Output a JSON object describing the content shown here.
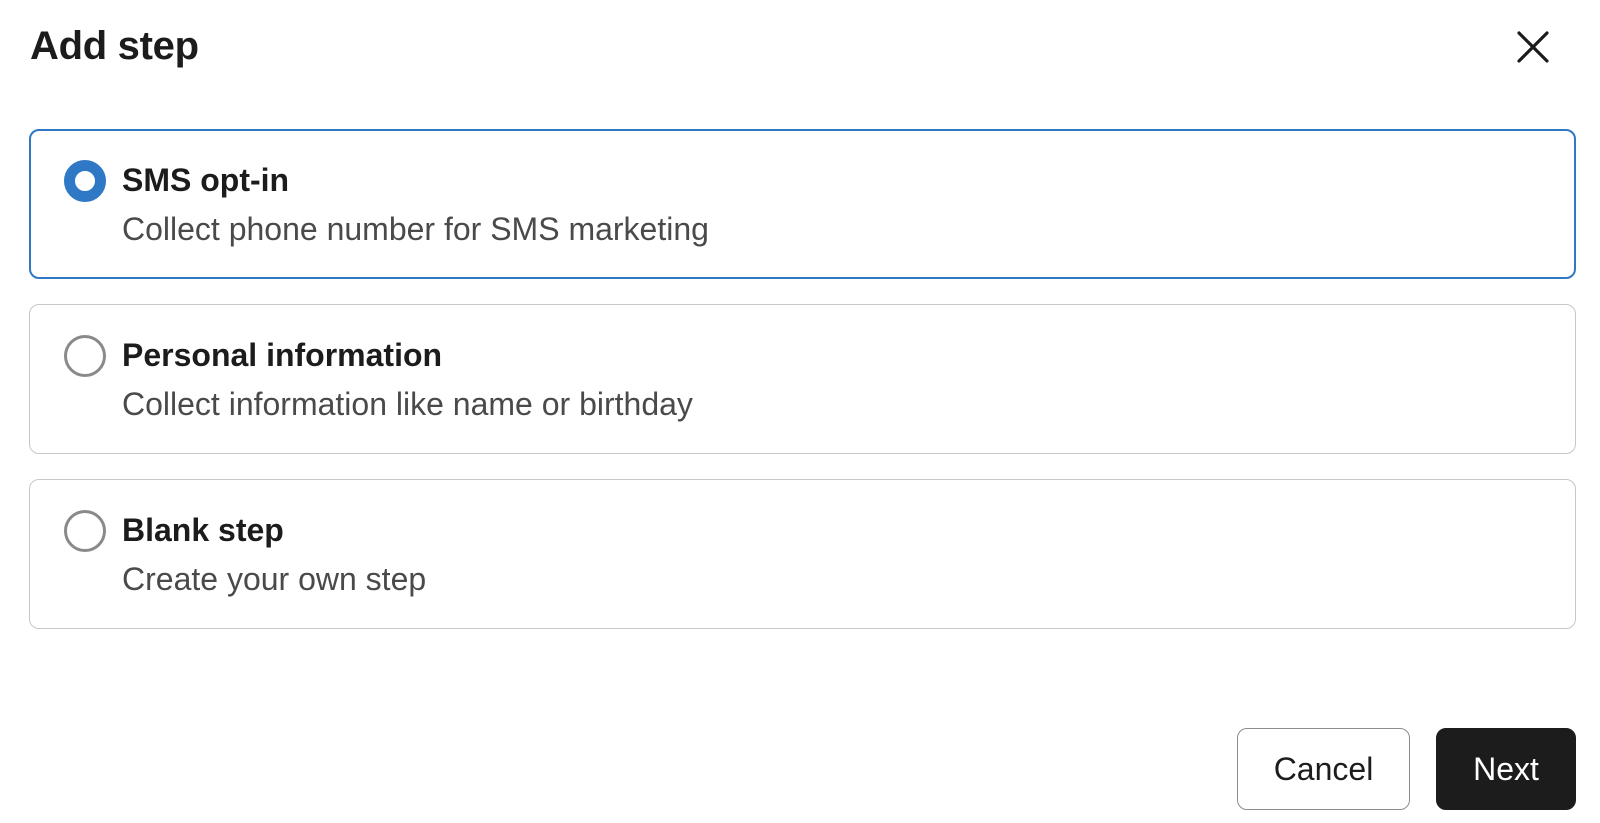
{
  "dialog": {
    "title": "Add step",
    "close_icon": "close-icon"
  },
  "options": [
    {
      "label": "SMS opt-in",
      "description": "Collect phone number for SMS marketing",
      "selected": true
    },
    {
      "label": "Personal information",
      "description": "Collect information like name or birthday",
      "selected": false
    },
    {
      "label": "Blank step",
      "description": "Create your own step",
      "selected": false
    }
  ],
  "footer": {
    "cancel_label": "Cancel",
    "next_label": "Next"
  },
  "colors": {
    "accent": "#2f78c6",
    "primary_button": "#1c1c1c",
    "border": "#c7c7c7"
  }
}
